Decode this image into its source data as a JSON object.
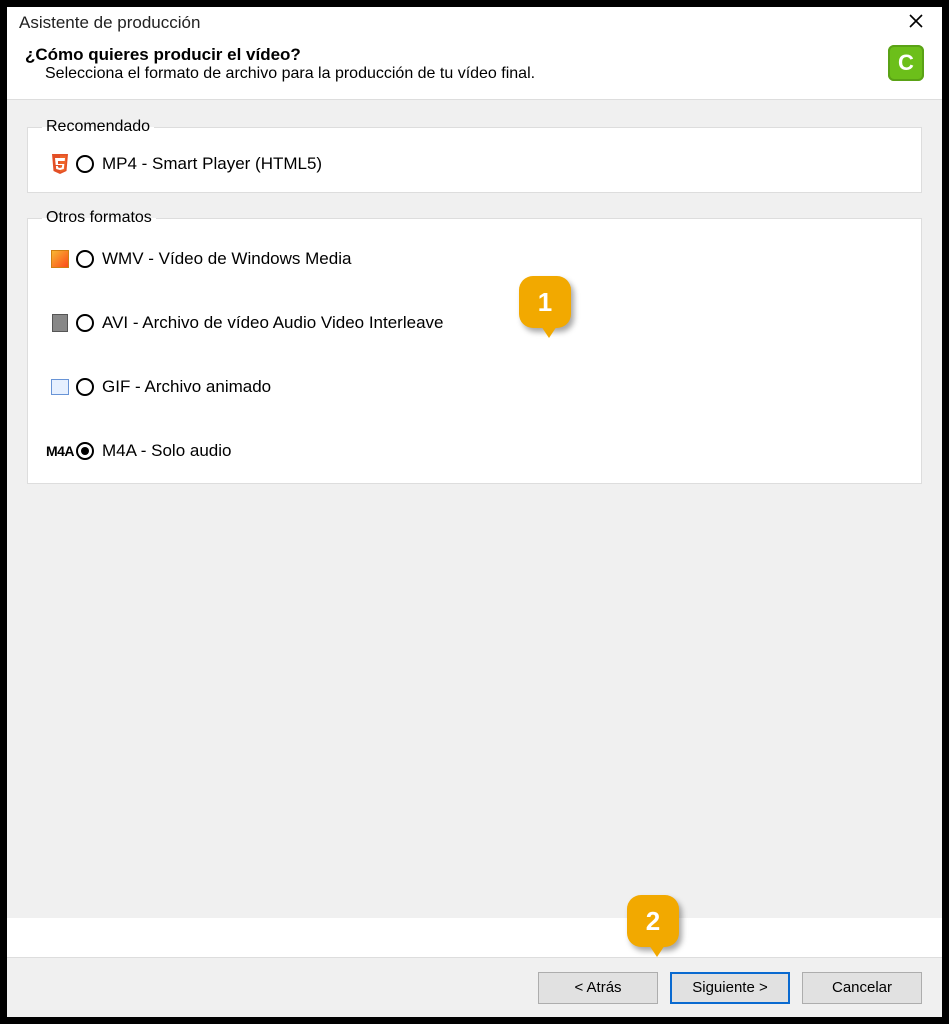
{
  "window": {
    "title": "Asistente de producción"
  },
  "header": {
    "question": "¿Cómo quieres producir el vídeo?",
    "subtitle": "Selecciona el formato de archivo para la producción de tu vídeo final."
  },
  "groups": {
    "recommended": {
      "legend": "Recomendado",
      "options": [
        {
          "id": "mp4",
          "label": "MP4 - Smart Player (HTML5)",
          "checked": false,
          "icon": "html5"
        }
      ]
    },
    "other": {
      "legend": "Otros formatos",
      "options": [
        {
          "id": "wmv",
          "label": "WMV - Vídeo de Windows Media",
          "checked": false,
          "icon": "wmv"
        },
        {
          "id": "avi",
          "label": "AVI - Archivo de vídeo Audio Video Interleave",
          "checked": false,
          "icon": "avi"
        },
        {
          "id": "gif",
          "label": "GIF - Archivo animado",
          "checked": false,
          "icon": "gif"
        },
        {
          "id": "m4a",
          "label": "M4A - Solo audio",
          "checked": true,
          "icon": "m4a"
        }
      ]
    }
  },
  "buttons": {
    "back": "< Atrás",
    "next": "Siguiente >",
    "cancel": "Cancelar"
  },
  "annotations": {
    "callout1": "1",
    "callout2": "2"
  },
  "logo_letter": "C",
  "icon_text": {
    "m4a": "M4A"
  }
}
